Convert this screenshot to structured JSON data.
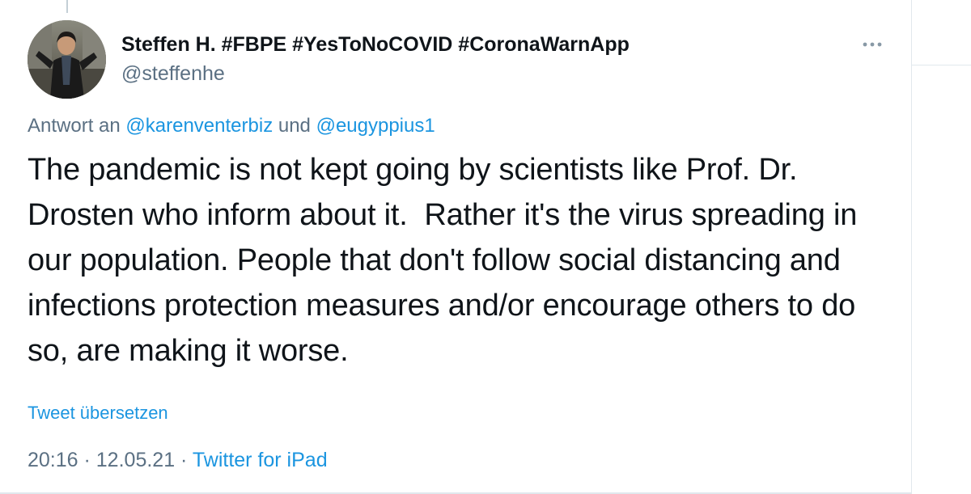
{
  "tweet": {
    "author": {
      "display_name": "Steffen H. #FBPE #YesToNoCOVID #CoronaWarnApp",
      "handle": "@steffenhe"
    },
    "reply_prefix": "Antwort an ",
    "reply_mention_1": "@karenventerbiz",
    "reply_conjunction": " und ",
    "reply_mention_2": "@eugyppius1",
    "text_lines": [
      "The pandemic is not kept going by scientists like Prof. Dr.",
      "Drosten who inform about it.  Rather it's the virus spreading in",
      "our population. People that don't follow social distancing and",
      "infections protection measures and/or encourage others to do",
      "so, are making it worse."
    ],
    "translate_label": "Tweet übersetzen",
    "time": "20:16",
    "separator": " · ",
    "date": "12.05.21",
    "source": "Twitter for iPad"
  },
  "colors": {
    "link": "#1b95e0",
    "secondary_text": "#5b7083",
    "primary_text": "#0f1419",
    "border": "#e1e8ed"
  },
  "icons": {
    "more": "more-horizontal-icon",
    "avatar": "avatar"
  }
}
